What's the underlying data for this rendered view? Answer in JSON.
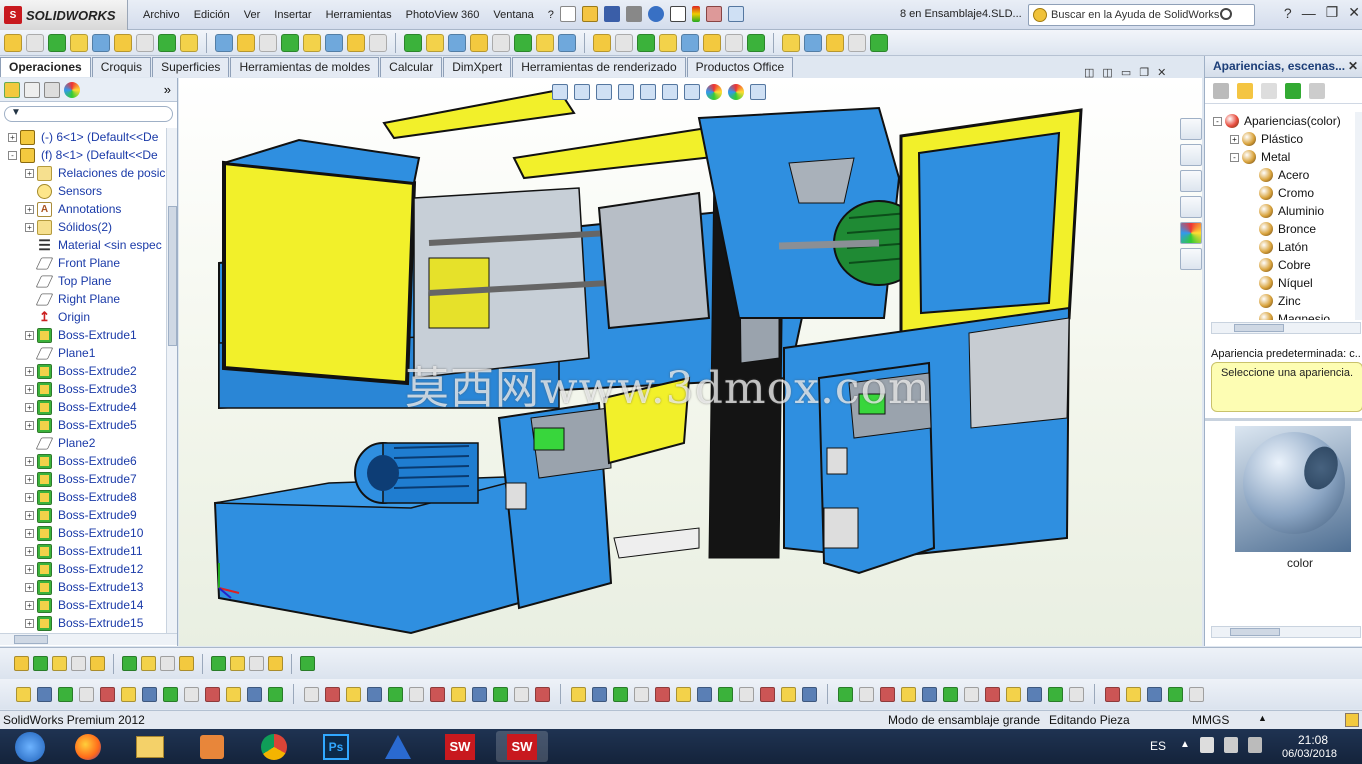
{
  "window": {
    "app_logo": "SOLIDWORKS",
    "doc_title": "8 en Ensamblaje4.SLD...",
    "help_search_placeholder": "Buscar en la Ayuda de SolidWorks",
    "minimize": "—",
    "restore": "❐",
    "close": "✕"
  },
  "menu": [
    "Archivo",
    "Edición",
    "Ver",
    "Insertar",
    "Herramientas",
    "PhotoView 360",
    "Ventana",
    "?"
  ],
  "tabs": [
    {
      "label": "Operaciones",
      "active": true
    },
    {
      "label": "Croquis",
      "active": false
    },
    {
      "label": "Superficies",
      "active": false
    },
    {
      "label": "Herramientas de moldes",
      "active": false
    },
    {
      "label": "Calcular",
      "active": false
    },
    {
      "label": "DimXpert",
      "active": false
    },
    {
      "label": "Herramientas de renderizado",
      "active": false
    },
    {
      "label": "Productos Office",
      "active": false
    }
  ],
  "tree": [
    {
      "label": "(-) 6<1> (Default<<De",
      "icon": "part",
      "expander": "+"
    },
    {
      "label": "(f) 8<1> (Default<<De",
      "icon": "part",
      "expander": "-"
    },
    {
      "label": "Relaciones de posic",
      "icon": "folder",
      "expander": "+",
      "indent": 1
    },
    {
      "label": "Sensors",
      "icon": "sensor",
      "expander": "",
      "indent": 1
    },
    {
      "label": "Annotations",
      "icon": "annot",
      "expander": "+",
      "indent": 1
    },
    {
      "label": "Sólidos(2)",
      "icon": "folder",
      "expander": "+",
      "indent": 1
    },
    {
      "label": "Material <sin espec",
      "icon": "mat",
      "expander": "",
      "indent": 1
    },
    {
      "label": "Front Plane",
      "icon": "plane",
      "expander": "",
      "indent": 1
    },
    {
      "label": "Top Plane",
      "icon": "plane",
      "expander": "",
      "indent": 1
    },
    {
      "label": "Right Plane",
      "icon": "plane",
      "expander": "",
      "indent": 1
    },
    {
      "label": "Origin",
      "icon": "origin",
      "expander": "",
      "indent": 1
    },
    {
      "label": "Boss-Extrude1",
      "icon": "extrude",
      "expander": "+",
      "indent": 1
    },
    {
      "label": "Plane1",
      "icon": "plane",
      "expander": "",
      "indent": 1
    },
    {
      "label": "Boss-Extrude2",
      "icon": "extrude",
      "expander": "+",
      "indent": 1
    },
    {
      "label": "Boss-Extrude3",
      "icon": "extrude",
      "expander": "+",
      "indent": 1
    },
    {
      "label": "Boss-Extrude4",
      "icon": "extrude",
      "expander": "+",
      "indent": 1
    },
    {
      "label": "Boss-Extrude5",
      "icon": "extrude",
      "expander": "+",
      "indent": 1
    },
    {
      "label": "Plane2",
      "icon": "plane",
      "expander": "",
      "indent": 1
    },
    {
      "label": "Boss-Extrude6",
      "icon": "extrude",
      "expander": "+",
      "indent": 1
    },
    {
      "label": "Boss-Extrude7",
      "icon": "extrude",
      "expander": "+",
      "indent": 1
    },
    {
      "label": "Boss-Extrude8",
      "icon": "extrude",
      "expander": "+",
      "indent": 1
    },
    {
      "label": "Boss-Extrude9",
      "icon": "extrude",
      "expander": "+",
      "indent": 1
    },
    {
      "label": "Boss-Extrude10",
      "icon": "extrude",
      "expander": "+",
      "indent": 1
    },
    {
      "label": "Boss-Extrude11",
      "icon": "extrude",
      "expander": "+",
      "indent": 1
    },
    {
      "label": "Boss-Extrude12",
      "icon": "extrude",
      "expander": "+",
      "indent": 1
    },
    {
      "label": "Boss-Extrude13",
      "icon": "extrude",
      "expander": "+",
      "indent": 1
    },
    {
      "label": "Boss-Extrude14",
      "icon": "extrude",
      "expander": "+",
      "indent": 1
    },
    {
      "label": "Boss-Extrude15",
      "icon": "extrude",
      "expander": "+",
      "indent": 1
    }
  ],
  "watermark": "莫西网www.3dmox.com",
  "taskpane": {
    "title": "Apariencias, escenas...",
    "items": [
      {
        "label": "Apariencias(color)",
        "expander": "-",
        "indent": 0,
        "color": "#e84c3d"
      },
      {
        "label": "Plástico",
        "expander": "+",
        "indent": 1,
        "color": "#d9a33c"
      },
      {
        "label": "Metal",
        "expander": "-",
        "indent": 1,
        "color": "#d9a33c"
      },
      {
        "label": "Acero",
        "expander": "",
        "indent": 2,
        "color": "#d9a33c"
      },
      {
        "label": "Cromo",
        "expander": "",
        "indent": 2,
        "color": "#d9a33c"
      },
      {
        "label": "Aluminio",
        "expander": "",
        "indent": 2,
        "color": "#d9a33c"
      },
      {
        "label": "Bronce",
        "expander": "",
        "indent": 2,
        "color": "#d9a33c"
      },
      {
        "label": "Latón",
        "expander": "",
        "indent": 2,
        "color": "#d9a33c"
      },
      {
        "label": "Cobre",
        "expander": "",
        "indent": 2,
        "color": "#d9a33c"
      },
      {
        "label": "Níquel",
        "expander": "",
        "indent": 2,
        "color": "#d9a33c"
      },
      {
        "label": "Zinc",
        "expander": "",
        "indent": 2,
        "color": "#d9a33c"
      },
      {
        "label": "Magnesio",
        "expander": "",
        "indent": 2,
        "color": "#d9a33c"
      }
    ],
    "default_label": "Apariencia predeterminada: c...",
    "note": "Seleccione una apariencia.",
    "preview_label": "color"
  },
  "status": {
    "product": "SolidWorks Premium 2012",
    "mode": "Modo de ensamblaje grande",
    "editing": "Editando Pieza",
    "units": "MMGS",
    "units_arrow": "▲"
  },
  "taskbar": {
    "lang": "ES",
    "time": "21:08",
    "date": "06/03/2018",
    "apps": [
      "start-button",
      "firefox",
      "file-explorer",
      "media-player",
      "chrome",
      "photoshop",
      "autodesk",
      "solidworks",
      "solidworks-active"
    ]
  },
  "colors": {
    "machine_blue": "#2f8fe0",
    "machine_yellow": "#f2f02a",
    "accent": "#1c3e78"
  }
}
